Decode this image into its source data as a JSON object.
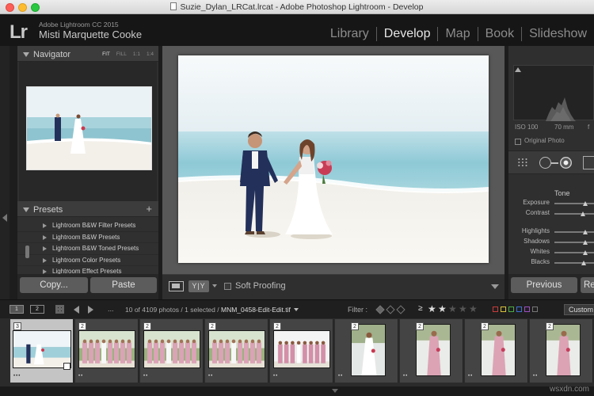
{
  "window": {
    "title": "Suzie_Dylan_LRCat.lrcat - Adobe Photoshop Lightroom - Develop"
  },
  "identity": {
    "logo": "Lr",
    "app_name": "Adobe Lightroom CC 2015",
    "user_name": "Misti Marquette Cooke"
  },
  "modules": [
    {
      "label": "Library"
    },
    {
      "label": "Develop",
      "active": true
    },
    {
      "label": "Map"
    },
    {
      "label": "Book"
    },
    {
      "label": "Slideshow"
    }
  ],
  "navigator": {
    "title": "Navigator",
    "zoom_options": [
      "FIT",
      "FILL",
      "1:1",
      "1:4"
    ],
    "selected_zoom": "FIT"
  },
  "presets": {
    "title": "Presets",
    "add_label": "+",
    "items": [
      "Lightroom B&W Filter Presets",
      "Lightroom B&W Presets",
      "Lightroom B&W Toned Presets",
      "Lightroom Color Presets",
      "Lightroom Effect Presets"
    ]
  },
  "left_buttons": {
    "copy": "Copy...",
    "paste": "Paste"
  },
  "toolbar": {
    "yy_label": "Y|Y",
    "soft_proofing": "Soft Proofing"
  },
  "histogram": {
    "iso": "ISO 100",
    "focal": "70 mm",
    "aperture": "f",
    "original_photo": "Original Photo"
  },
  "tone": {
    "title": "Tone",
    "sliders": [
      {
        "label": "Exposure",
        "value": 0.78
      },
      {
        "label": "Contrast",
        "value": 0.72
      },
      {
        "label": "Highlights",
        "value": 0.78
      },
      {
        "label": "Shadows",
        "value": 0.78
      },
      {
        "label": "Whites",
        "value": 0.78
      },
      {
        "label": "Blacks",
        "value": 0.74
      }
    ]
  },
  "right_buttons": {
    "previous": "Previous",
    "reset": "Re"
  },
  "filmstrip_bar": {
    "screen_1": "1",
    "screen_2": "2",
    "dots": "...",
    "count_text": "10 of 4109 photos / 1 selected / ",
    "filename": "MNM_0458-Edit-Edit.tif",
    "filter_label": "Filter :",
    "rating_op": "≥",
    "stars_filled": 2,
    "stars_total": 5,
    "color_labels": [
      "#c83b3b",
      "#d6c23a",
      "#4caa45",
      "#3f6fd0",
      "#9b4fc0",
      "#777777"
    ],
    "custom_label": "Custom"
  },
  "filmstrip": [
    {
      "num": "3",
      "type": "couple-beach",
      "selected": true,
      "stars": "•••"
    },
    {
      "num": "2",
      "type": "bridal-party",
      "stars": "••"
    },
    {
      "num": "2",
      "type": "bridal-party",
      "stars": "••"
    },
    {
      "num": "2",
      "type": "bridal-party",
      "stars": "••"
    },
    {
      "num": "2",
      "type": "bridal-party-white",
      "stars": "••"
    },
    {
      "num": "2",
      "type": "bride-portrait",
      "stars": "••"
    },
    {
      "num": "2",
      "type": "bridesmaid-portrait",
      "stars": "••"
    },
    {
      "num": "2",
      "type": "bridesmaid-portrait",
      "stars": "••"
    },
    {
      "num": "2",
      "type": "bridesmaid-portrait",
      "stars": "••"
    }
  ],
  "watermark": "wsxdn.com"
}
